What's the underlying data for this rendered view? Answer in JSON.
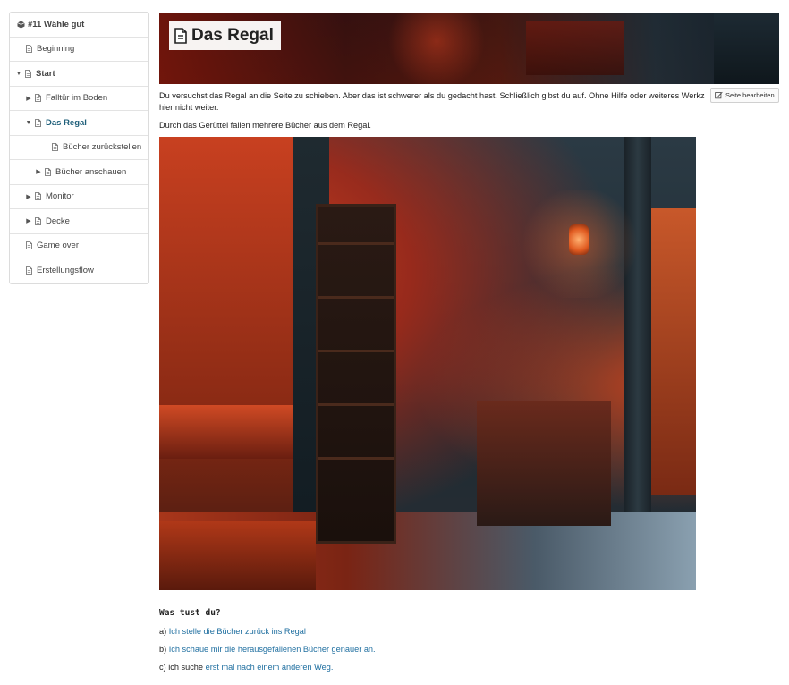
{
  "sidebar": {
    "items": [
      {
        "label": "#11 Wähle gut",
        "caret": "",
        "icon": "cube-icon",
        "indent": 0,
        "state": "top"
      },
      {
        "label": "Beginning",
        "caret": "",
        "icon": "document-icon",
        "indent": 0,
        "state": ""
      },
      {
        "label": "Start",
        "caret": "▼",
        "icon": "document-icon",
        "indent": 0,
        "state": "bold"
      },
      {
        "label": "Falltür im Boden",
        "caret": "▶",
        "icon": "document-icon",
        "indent": 1,
        "state": ""
      },
      {
        "label": "Das Regal",
        "caret": "▼",
        "icon": "document-icon",
        "indent": 1,
        "state": "active"
      },
      {
        "label": "Bücher zurückstellen",
        "caret": "",
        "icon": "document-icon",
        "indent": 2,
        "state": ""
      },
      {
        "label": "Bücher anschauen",
        "caret": "▶",
        "icon": "document-icon",
        "indent": 2,
        "state": ""
      },
      {
        "label": "Monitor",
        "caret": "▶",
        "icon": "document-icon",
        "indent": 1,
        "state": ""
      },
      {
        "label": "Decke",
        "caret": "▶",
        "icon": "document-icon",
        "indent": 1,
        "state": ""
      },
      {
        "label": "Game over",
        "caret": "",
        "icon": "document-icon",
        "indent": 0,
        "state": ""
      },
      {
        "label": "Erstellungsflow",
        "caret": "",
        "icon": "document-icon",
        "indent": 0,
        "state": ""
      }
    ]
  },
  "page": {
    "title": "Das Regal",
    "edit_label": "Seite bearbeiten",
    "intro_line1": "Du versuchst das Regal an die Seite zu schieben. Aber das ist schwerer als du gedacht hast. Schließlich gibst du auf. Ohne Hilfe oder weiteres Werkz",
    "intro_line2": "hier nicht weiter.",
    "intro_2": "Durch das Gerüttel fallen mehrere Bücher aus dem Regal.",
    "question": "Was tust du?",
    "options": [
      {
        "prefix": "a) ",
        "link": "Ich stelle die Bücher zurück ins Regal",
        "suffix": ""
      },
      {
        "prefix": "b) ",
        "link": "Ich schaue mir die herausgefallenen Bücher genauer an.",
        "suffix": ""
      },
      {
        "prefix": "c) ich suche ",
        "link": "erst mal nach einem anderen Weg.",
        "suffix": ""
      }
    ]
  },
  "colors": {
    "link": "#1f6fa0",
    "active_nav": "#1f5f7a"
  }
}
